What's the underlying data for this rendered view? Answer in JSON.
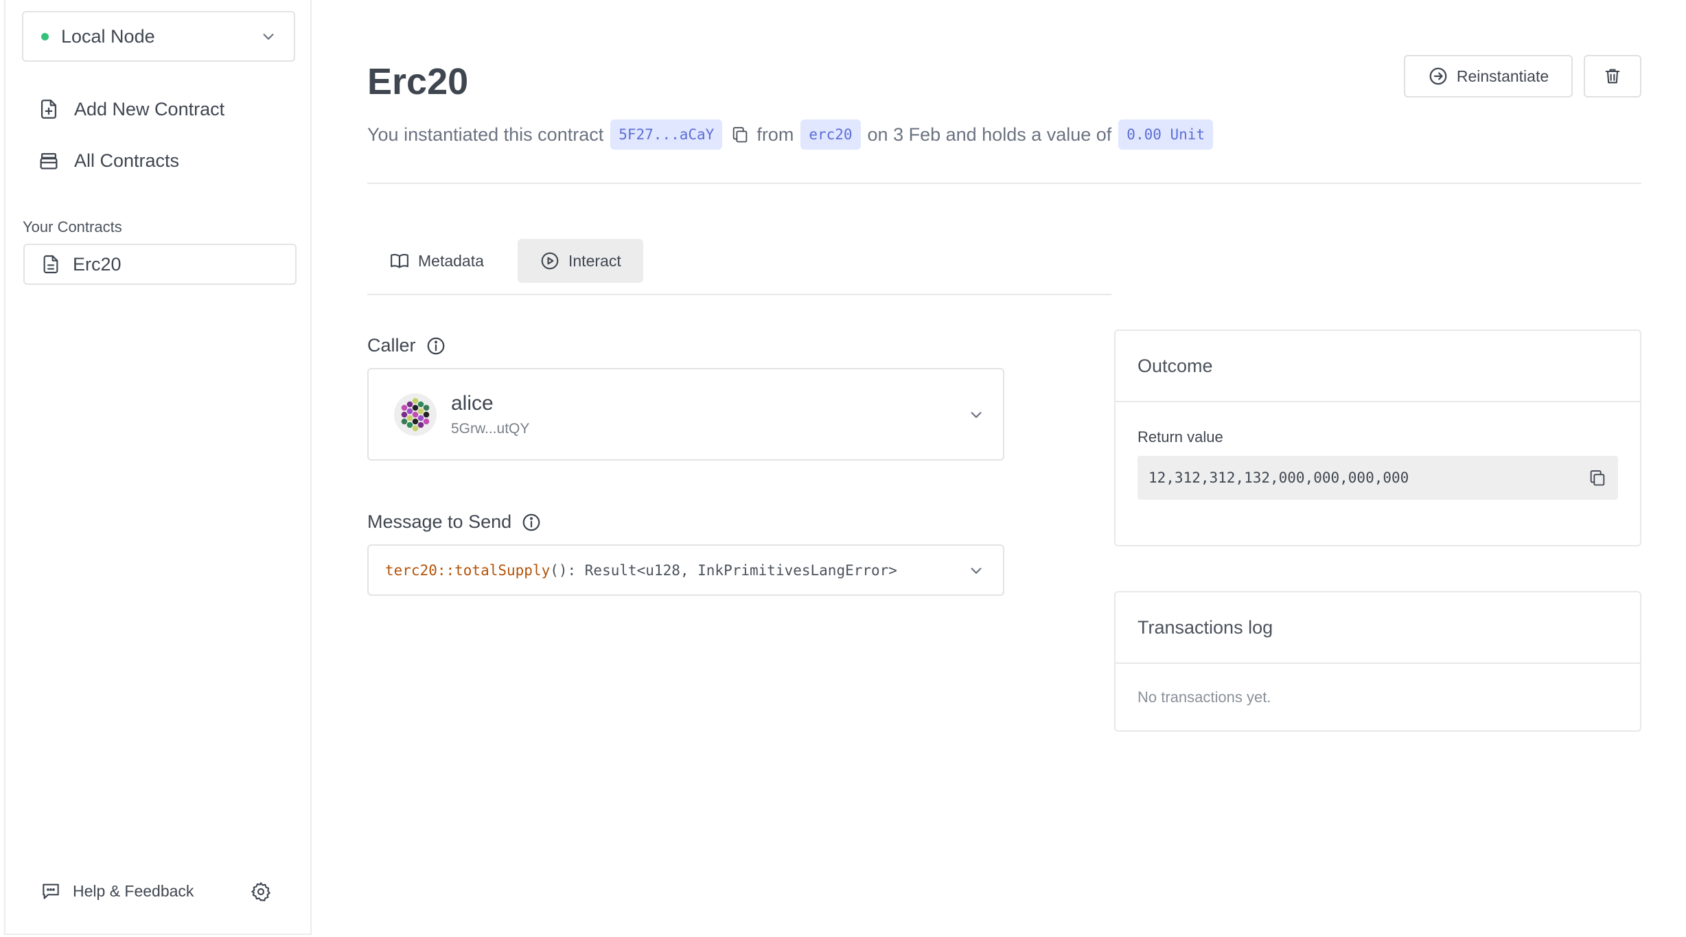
{
  "sidebar": {
    "node_label": "Local Node",
    "nav": [
      {
        "label": "Add New Contract",
        "icon": "file-plus-icon"
      },
      {
        "label": "All Contracts",
        "icon": "database-icon"
      }
    ],
    "section_label": "Your Contracts",
    "contracts": [
      {
        "label": "Erc20"
      }
    ],
    "help_label": "Help & Feedback"
  },
  "contract": {
    "title": "Erc20",
    "subtitle": {
      "prefix": "You instantiated this contract",
      "address": "5F27...aCaY",
      "from_text": "from",
      "code": "erc20",
      "date_text": "on 3 Feb and holds a value of",
      "value": "0.00 Unit"
    },
    "reinstantiate_label": "Reinstantiate"
  },
  "tabs": [
    {
      "label": "Metadata",
      "active": false
    },
    {
      "label": "Interact",
      "active": true
    }
  ],
  "caller": {
    "label": "Caller",
    "name": "alice",
    "address": "5Grw...utQY"
  },
  "message": {
    "label": "Message to Send",
    "fn_name": "terc20::totalSupply",
    "signature": "(): Result<u128, InkPrimitivesLangError>"
  },
  "outcome": {
    "title": "Outcome",
    "return_label": "Return value",
    "return_value": "12,312,312,132,000,000,000,000"
  },
  "transactions": {
    "title": "Transactions log",
    "empty_text": "No transactions yet."
  },
  "colors": {
    "status_dot": "#34c27b",
    "chip_bg": "#e0e7ff",
    "chip_text": "#5d6ed6",
    "fn_name": "#b45309"
  }
}
